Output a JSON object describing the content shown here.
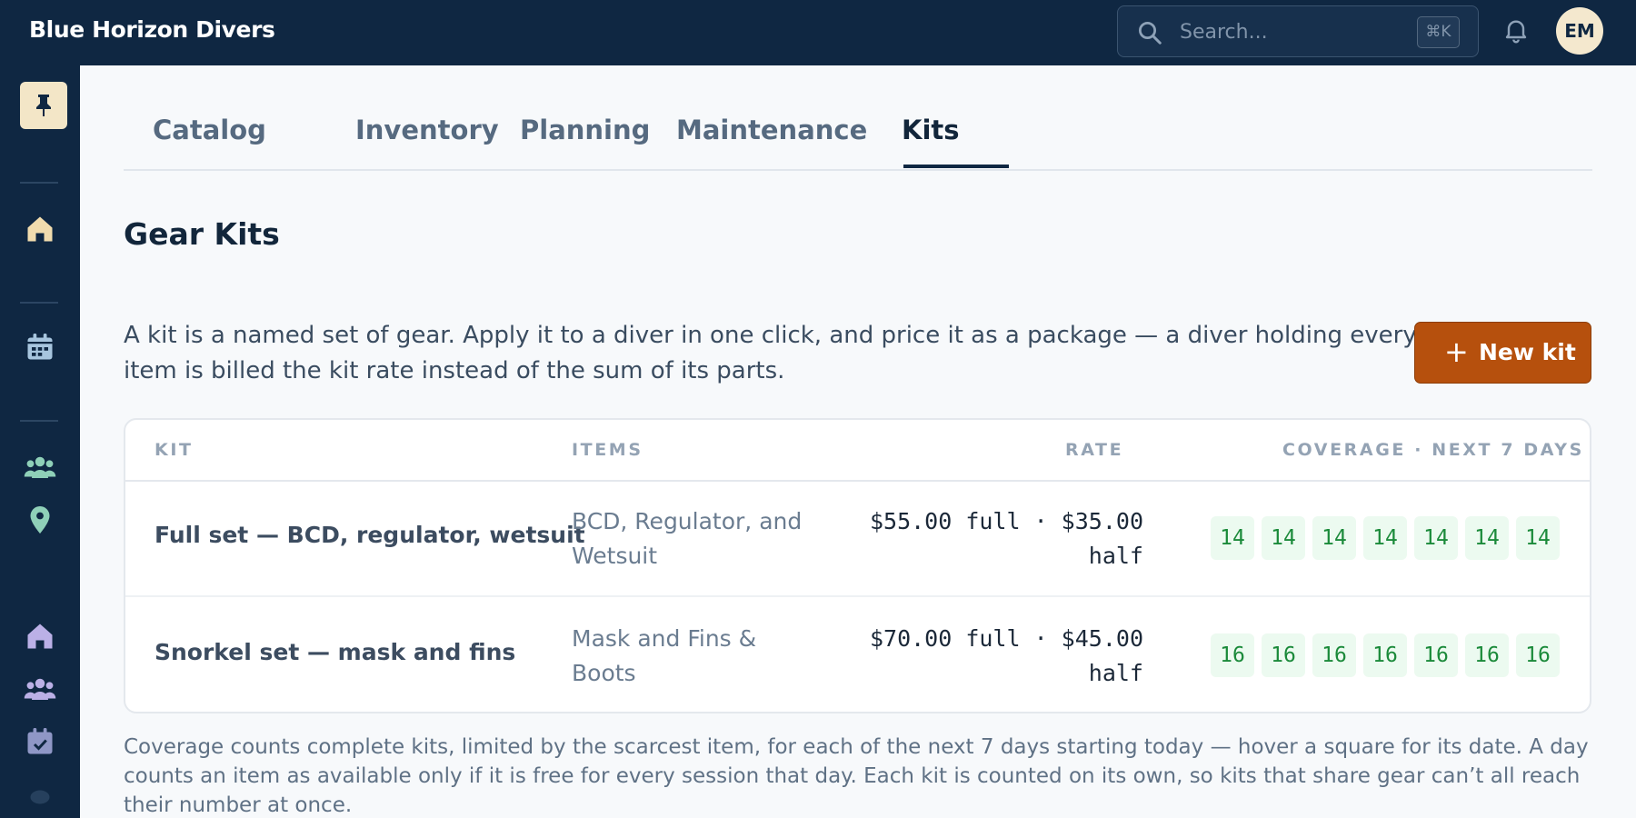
{
  "app": {
    "brand": "Blue Horizon Divers",
    "search_placeholder": "Search...",
    "search_shortcut": "⌘K",
    "user_initials": "EM"
  },
  "sidebar": {
    "icons": [
      "pin-icon",
      "home-icon",
      "calendar-icon",
      "users-icon",
      "map-pin-icon",
      "home-icon",
      "users-icon",
      "calendar-check-icon"
    ]
  },
  "tabs": [
    {
      "label": "Catalog",
      "active": false
    },
    {
      "label": "Inventory",
      "active": false
    },
    {
      "label": "Planning",
      "active": false
    },
    {
      "label": "Maintenance",
      "active": false
    },
    {
      "label": "Kits",
      "active": true
    }
  ],
  "page": {
    "title": "Gear Kits",
    "intro": "A kit is a named set of gear. Apply it to a diver in one click, and price it as a package — a diver holding every item is billed the kit rate instead of the sum of its parts.",
    "new_kit_label": "New kit",
    "footnote": "Coverage counts complete kits, limited by the scarcest item, for each of the next 7 days starting today — hover a square for its date. A day counts an item as available only if it is free for every session that day. Each kit is counted on its own, so kits that share gear can’t all reach their number at once."
  },
  "table": {
    "headers": {
      "kit": "KIT",
      "items": "ITEMS",
      "rate": "RATE",
      "coverage": "COVERAGE · NEXT 7 DAYS"
    },
    "rows": [
      {
        "kit": "Full set — BCD, regulator, wetsuit",
        "items": "BCD, Regulator, and Wetsuit",
        "rate": "$55.00 full · $35.00 half",
        "coverage": [
          "14",
          "14",
          "14",
          "14",
          "14",
          "14",
          "14"
        ]
      },
      {
        "kit": "Snorkel set — mask and fins",
        "items": "Mask and Fins & Boots",
        "rate": "$70.00 full · $45.00 half",
        "coverage": [
          "16",
          "16",
          "16",
          "16",
          "16",
          "16",
          "16"
        ]
      }
    ]
  },
  "colors": {
    "topbar": "#0f2742",
    "accent_button": "#b6500d",
    "coverage_text": "#1b8a3a",
    "coverage_bg": "#ecfaf0"
  }
}
